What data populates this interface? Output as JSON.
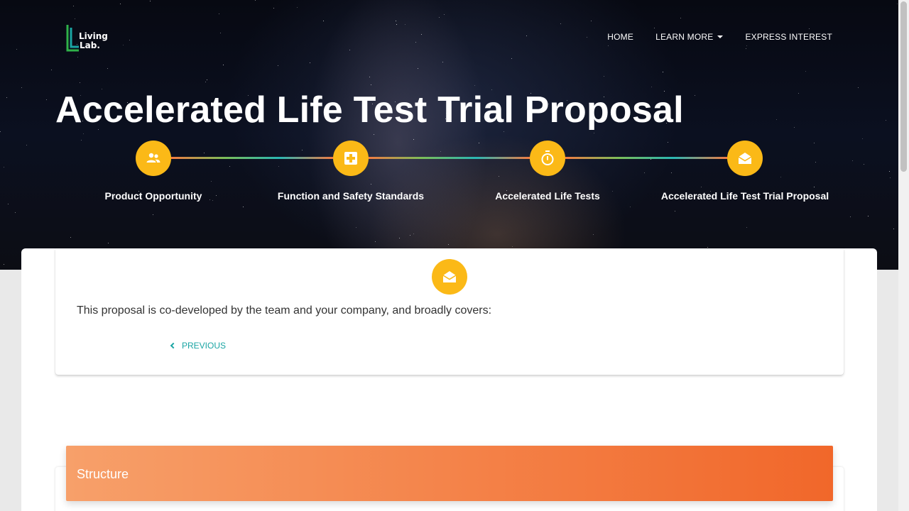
{
  "brand": {
    "logo_line1": "Living",
    "logo_line2": "Lab.",
    "colors": {
      "logo_green": "#2fb24a",
      "logo_teal": "#1aa5a3",
      "accent_yellow": "#fbb917",
      "accent_orange": "#f1672a"
    }
  },
  "nav": {
    "items": [
      {
        "label": "HOME",
        "has_dropdown": false
      },
      {
        "label": "LEARN MORE",
        "has_dropdown": true
      },
      {
        "label": "EXPRESS INTEREST",
        "has_dropdown": false
      }
    ]
  },
  "hero": {
    "title": "Accelerated Life Test Trial Proposal"
  },
  "steps": [
    {
      "label": "Product Opportunity",
      "icon": "people-icon"
    },
    {
      "label": "Function and Safety Standards",
      "icon": "medical-cross-icon"
    },
    {
      "label": "Accelerated Life Tests",
      "icon": "stopwatch-icon"
    },
    {
      "label": "Accelerated Life Test Trial Proposal",
      "icon": "open-envelope-icon"
    }
  ],
  "card": {
    "icon": "open-envelope-icon",
    "text": "This proposal is co-developed by the team and your company, and broadly covers:",
    "previous_label": "PREVIOUS"
  },
  "structure": {
    "title": "Structure"
  }
}
